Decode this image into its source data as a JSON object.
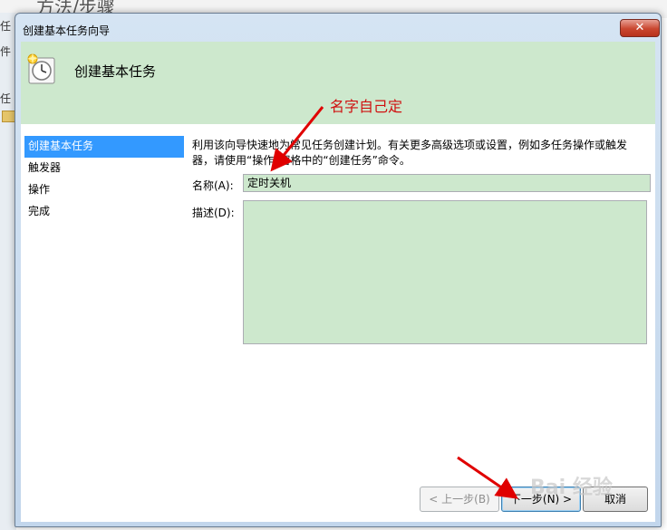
{
  "background": {
    "top_text": "方法/步骤",
    "left_fragments": [
      "任",
      "件",
      "任"
    ]
  },
  "window": {
    "title": "创建基本任务向导",
    "close_glyph": "✕"
  },
  "header": {
    "title": "创建基本任务"
  },
  "annotation": {
    "text": "名字自己定",
    "color": "#d01010"
  },
  "steps": [
    {
      "label": "创建基本任务",
      "active": true
    },
    {
      "label": "触发器",
      "active": false
    },
    {
      "label": "操作",
      "active": false
    },
    {
      "label": "完成",
      "active": false
    }
  ],
  "main": {
    "description": "利用该向导快速地为常见任务创建计划。有关更多高级选项或设置，例如多任务操作或触发器，请使用“操作”窗格中的“创建任务”命令。",
    "name_label": "名称(A):",
    "name_value": "定时关机",
    "desc_label": "描述(D):",
    "desc_value": ""
  },
  "footer": {
    "back_label": "< 上一步(B)",
    "next_label": "下一步(N) >",
    "cancel_label": "取消"
  },
  "watermark": "Bai 经验",
  "colors": {
    "header_bg": "#cde8cd",
    "active_step": "#3399ff",
    "close_red": "#c9462f"
  }
}
